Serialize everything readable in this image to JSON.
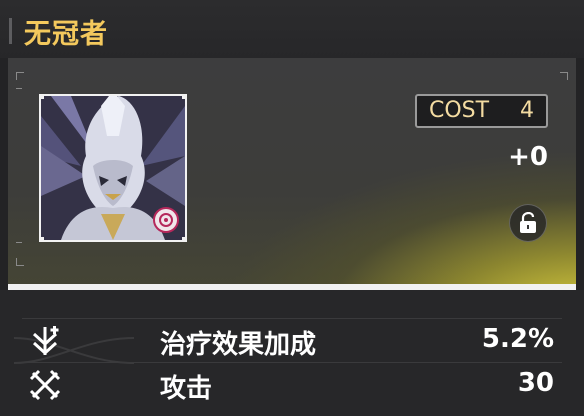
{
  "header": {
    "title": "无冠者"
  },
  "card": {
    "cost_label": "COST",
    "cost_value": "4",
    "bonus": "+0",
    "portrait_icon": "echo-portrait",
    "lock_icon": "unlock-icon"
  },
  "stats": [
    {
      "name": "治疗效果加成",
      "value": "5.2%",
      "icon": "healing-bonus-icon"
    },
    {
      "name": "攻击",
      "value": "30",
      "icon": "attack-icon"
    }
  ],
  "colors": {
    "title": "#f4c95d",
    "cost_text": "#f4dca2",
    "glow": "#e2d63f",
    "background": "#232325"
  }
}
